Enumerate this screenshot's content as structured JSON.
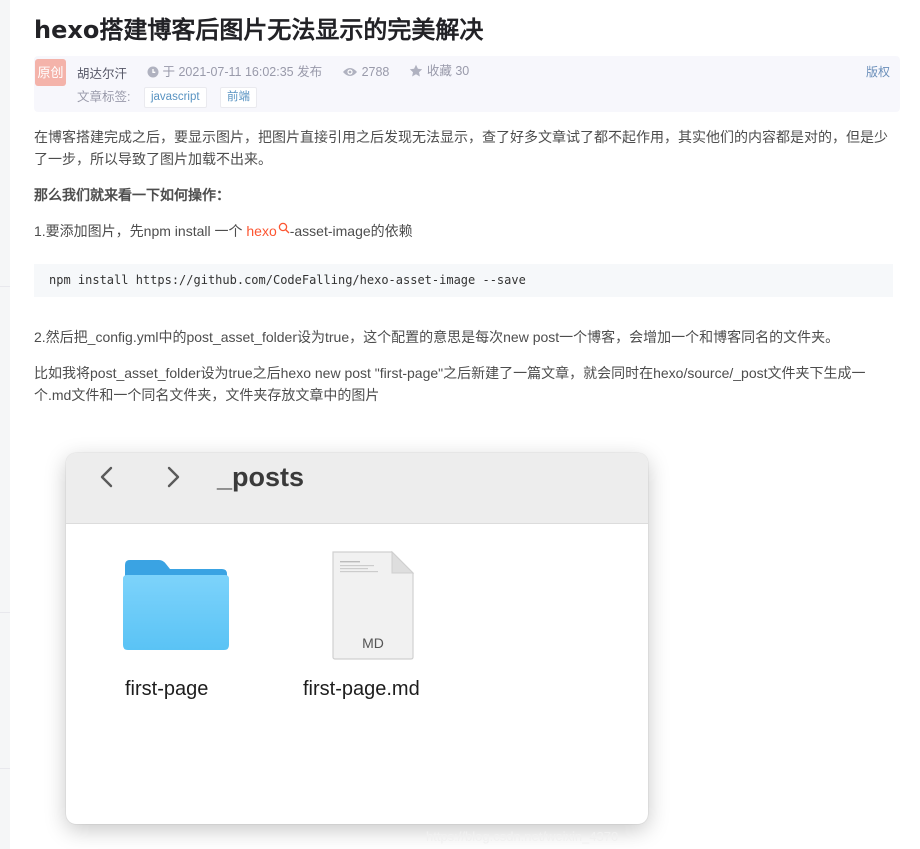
{
  "article": {
    "title": "hexo搭建博客后图片无法显示的完美解决",
    "meta": {
      "badge": "原创",
      "author": "胡达尔汗",
      "publish": "于 2021-07-11 16:02:35 发布",
      "views": "2788",
      "favorites": "收藏 30",
      "rights": "版权",
      "tags_label": "文章标签:",
      "tags": [
        "javascript",
        "前端"
      ]
    },
    "para1": "在博客搭建完成之后，要显示图片，把图片直接引用之后发现无法显示，查了好多文章试了都不起作用，其实他们的内容都是对的，但是少了一步，所以导致了图片加载不出来。",
    "para2": "那么我们就来看一下如何操作：",
    "para3": {
      "before": "1.要添加图片，先npm install 一个 ",
      "link": "hexo",
      "after": "-asset-image的依赖"
    },
    "code": "npm install https://github.com/CodeFalling/hexo-asset-image --save",
    "para4": "2.然后把_config.yml中的post_asset_folder设为true，这个配置的意思是每次new post一个博客，会增加一个和博客同名的文件夹。",
    "para5": "比如我将post_asset_folder设为true之后hexo new post \"first-page\"之后新建了一篇文章，就会同时在hexo/source/_post文件夹下生成一个.md文件和一个同名文件夹，文件夹存放文章中的图片",
    "finder": {
      "folder_name": "_posts",
      "items": [
        {
          "label": "first-page",
          "kind": "folder"
        },
        {
          "label": "first-page.md",
          "kind": "file",
          "file_badge": "MD"
        }
      ]
    },
    "watermark": "https://blog.csdn.net/weixin_4370"
  },
  "colors": {
    "link": "#fc5531",
    "tag_text": "#5893c2",
    "badge_bg": "#f4b3aa",
    "folder_blue": "#5ac3f5"
  }
}
